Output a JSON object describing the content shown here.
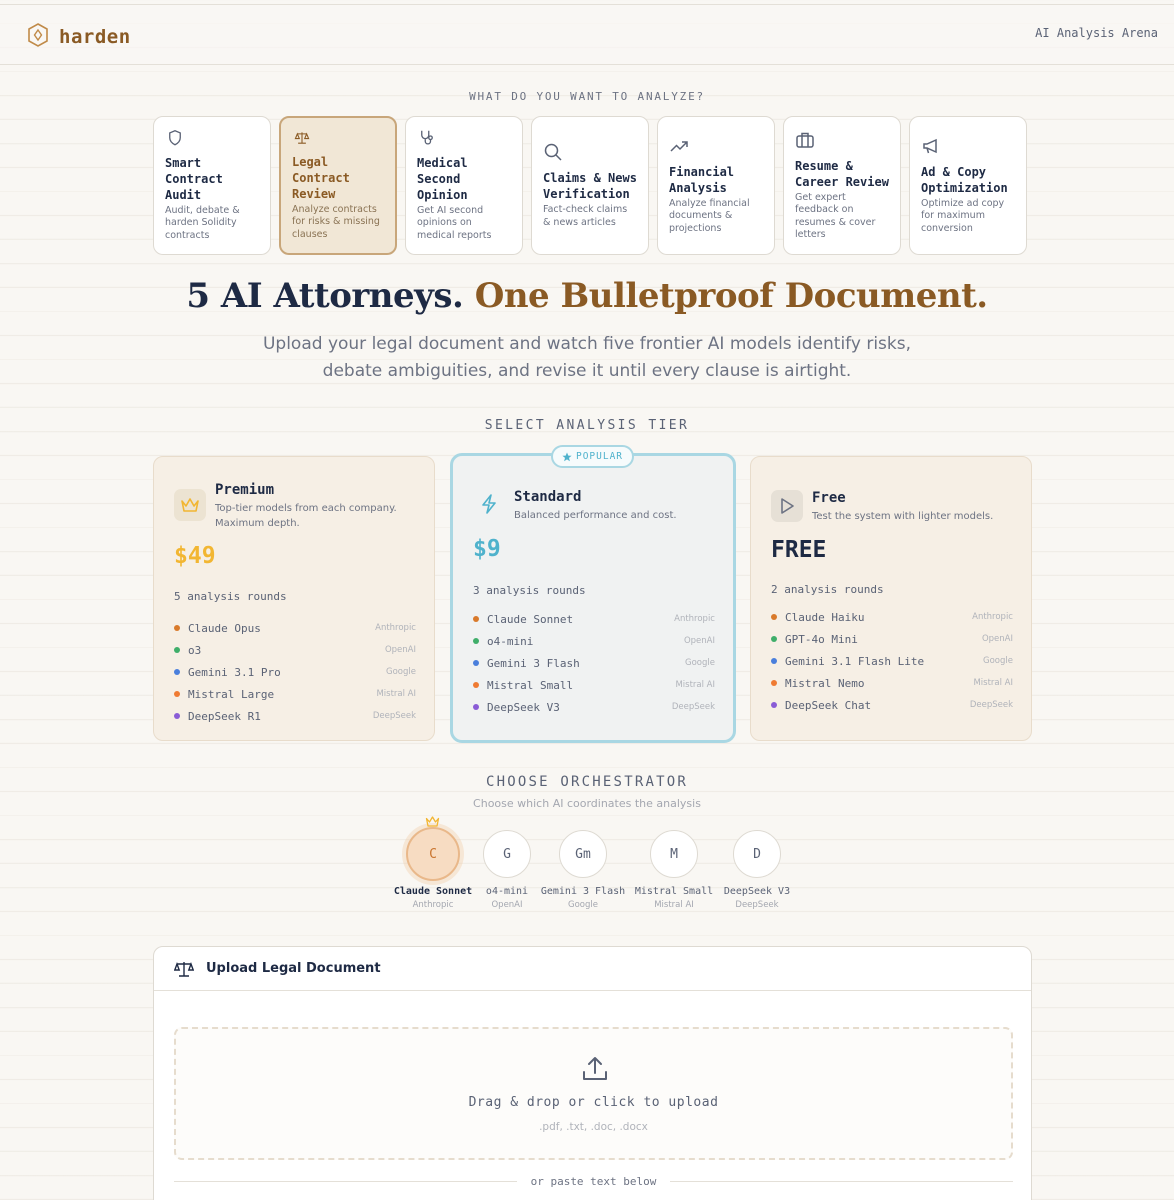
{
  "header": {
    "logo_text": "harden",
    "right_label": "AI Analysis Arena"
  },
  "categories_label": "WHAT DO YOU WANT TO ANALYZE?",
  "categories": [
    {
      "title": "Smart Contract Audit",
      "desc": "Audit, debate & harden Solidity contracts",
      "icon": "shield-icon"
    },
    {
      "title": "Legal Contract Review",
      "desc": "Analyze contracts for risks & missing clauses",
      "icon": "scales-icon",
      "active": true
    },
    {
      "title": "Medical Second Opinion",
      "desc": "Get AI second opinions on medical reports",
      "icon": "stethoscope-icon"
    },
    {
      "title": "Claims & News Verification",
      "desc": "Fact-check claims & news articles",
      "icon": "search-icon"
    },
    {
      "title": "Financial Analysis",
      "desc": "Analyze financial documents & projections",
      "icon": "trending-up-icon"
    },
    {
      "title": "Resume & Career Review",
      "desc": "Get expert feedback on resumes & cover letters",
      "icon": "briefcase-icon"
    },
    {
      "title": "Ad & Copy Optimization",
      "desc": "Optimize ad copy for maximum conversion",
      "icon": "megaphone-icon"
    }
  ],
  "hero": {
    "title_main": "5 AI Attorneys. ",
    "title_accent": "One Bulletproof Document.",
    "subtitle_line1": "Upload your legal document and watch five frontier AI models identify risks,",
    "subtitle_line2": "debate ambiguities, and revise it until every clause is airtight."
  },
  "tiers_label": "SELECT ANALYSIS TIER",
  "popular_badge": "POPULAR",
  "tiers": [
    {
      "name": "Premium",
      "desc": "Top-tier models from each company. Maximum depth.",
      "price": "$49",
      "rounds": "5 analysis rounds",
      "price_color": "#f2b632",
      "models": [
        {
          "name": "Claude Opus",
          "company": "Anthropic",
          "color": "#d97a2b"
        },
        {
          "name": "o3",
          "company": "OpenAI",
          "color": "#3fae6a"
        },
        {
          "name": "Gemini 3.1 Pro",
          "company": "Google",
          "color": "#4a7fdc"
        },
        {
          "name": "Mistral Large",
          "company": "Mistral AI",
          "color": "#ef7b33"
        },
        {
          "name": "DeepSeek R1",
          "company": "DeepSeek",
          "color": "#8a5cd6"
        }
      ]
    },
    {
      "name": "Standard",
      "desc": "Balanced performance and cost.",
      "price": "$9",
      "rounds": "3 analysis rounds",
      "price_color": "#4fb2cc",
      "models": [
        {
          "name": "Claude Sonnet",
          "company": "Anthropic",
          "color": "#d97a2b"
        },
        {
          "name": "o4-mini",
          "company": "OpenAI",
          "color": "#3fae6a"
        },
        {
          "name": "Gemini 3 Flash",
          "company": "Google",
          "color": "#4a7fdc"
        },
        {
          "name": "Mistral Small",
          "company": "Mistral AI",
          "color": "#ef7b33"
        },
        {
          "name": "DeepSeek V3",
          "company": "DeepSeek",
          "color": "#8a5cd6"
        }
      ]
    },
    {
      "name": "Free",
      "desc": "Test the system with lighter models.",
      "price": "FREE",
      "rounds": "2 analysis rounds",
      "price_color": "#1e2a44",
      "models": [
        {
          "name": "Claude Haiku",
          "company": "Anthropic",
          "color": "#d97a2b"
        },
        {
          "name": "GPT-4o Mini",
          "company": "OpenAI",
          "color": "#3fae6a"
        },
        {
          "name": "Gemini 3.1 Flash Lite",
          "company": "Google",
          "color": "#4a7fdc"
        },
        {
          "name": "Mistral Nemo",
          "company": "Mistral AI",
          "color": "#ef7b33"
        },
        {
          "name": "DeepSeek Chat",
          "company": "DeepSeek",
          "color": "#8a5cd6"
        }
      ]
    }
  ],
  "orchestrator": {
    "title": "CHOOSE ORCHESTRATOR",
    "subtitle": "Choose which AI coordinates the analysis",
    "options": [
      {
        "initial": "C",
        "name": "Claude Sonnet",
        "company": "Anthropic",
        "selected": true
      },
      {
        "initial": "G",
        "name": "o4-mini",
        "company": "OpenAI"
      },
      {
        "initial": "Gm",
        "name": "Gemini 3 Flash",
        "company": "Google"
      },
      {
        "initial": "M",
        "name": "Mistral Small",
        "company": "Mistral AI"
      },
      {
        "initial": "D",
        "name": "DeepSeek V3",
        "company": "DeepSeek"
      }
    ]
  },
  "upload": {
    "title": "Upload Legal Document",
    "drop_text": "Drag & drop or click to upload",
    "extensions": ".pdf, .txt, .doc, .docx",
    "paste_label": "or paste text below"
  },
  "colors": {
    "brand": "#8a5a24",
    "accent_blue": "#4fb2cc",
    "accent_gold": "#f2b632"
  }
}
